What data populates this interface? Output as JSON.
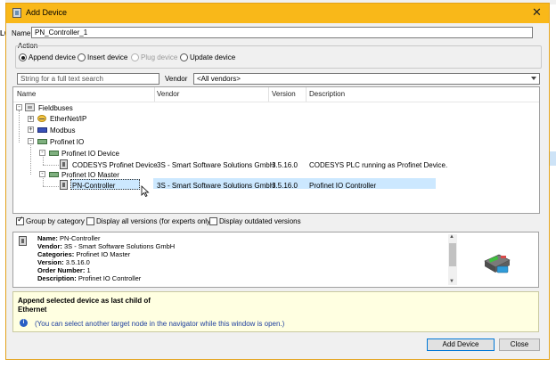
{
  "background": {
    "left_label": "LC"
  },
  "dialog": {
    "title": "Add Device",
    "title_bar_color": "#f9b819",
    "name_label": "Name",
    "name_value": "PN_Controller_1",
    "action": {
      "group_label": "Action",
      "options": [
        {
          "label": "Append device",
          "selected": true,
          "enabled": true
        },
        {
          "label": "Insert device",
          "selected": false,
          "enabled": true
        },
        {
          "label": "Plug device",
          "selected": false,
          "enabled": false
        },
        {
          "label": "Update device",
          "selected": false,
          "enabled": true
        }
      ]
    },
    "search_placeholder": "String for a full text search",
    "vendor_label": "Vendor",
    "vendor_value": "<All vendors>",
    "columns": [
      "Name",
      "Vendor",
      "Version",
      "Description"
    ],
    "tree": {
      "root": "Fieldbuses",
      "ethernet": "EtherNet/IP",
      "modbus": "Modbus",
      "profinet": "Profinet IO",
      "profinet_device": "Profinet IO Device",
      "codesys_device": {
        "name": "CODESYS Profinet Device",
        "vendor": "3S - Smart Software Solutions GmbH",
        "version": "3.5.16.0",
        "description": "CODESYS PLC running as Profinet Device."
      },
      "profinet_master": "Profinet IO Master",
      "pn_controller": {
        "name": "PN-Controller",
        "vendor": "3S - Smart Software Solutions GmbH",
        "version": "3.5.16.0",
        "description": "Profinet IO Controller"
      }
    },
    "options": {
      "group_by_category": {
        "label": "Group by category",
        "checked": true
      },
      "display_all_versions": {
        "label": "Display all versions (for experts only)",
        "checked": false
      },
      "display_outdated": {
        "label": "Display outdated versions",
        "checked": false
      }
    },
    "details": [
      {
        "key": "Name:",
        "value": "PN-Controller"
      },
      {
        "key": "Vendor:",
        "value": "3S - Smart Software Solutions GmbH"
      },
      {
        "key": "Categories:",
        "value": "Profinet IO Master"
      },
      {
        "key": "Version:",
        "value": "3.5.16.0"
      },
      {
        "key": "Order Number:",
        "value": "1"
      },
      {
        "key": "Description:",
        "value": "Profinet IO Controller"
      }
    ],
    "hint": {
      "line1": "Append selected device as last child of",
      "line2": "Ethernet",
      "note": "(You can select another target node in the navigator while this window is open.)"
    },
    "buttons": {
      "add": "Add Device",
      "close": "Close"
    }
  }
}
